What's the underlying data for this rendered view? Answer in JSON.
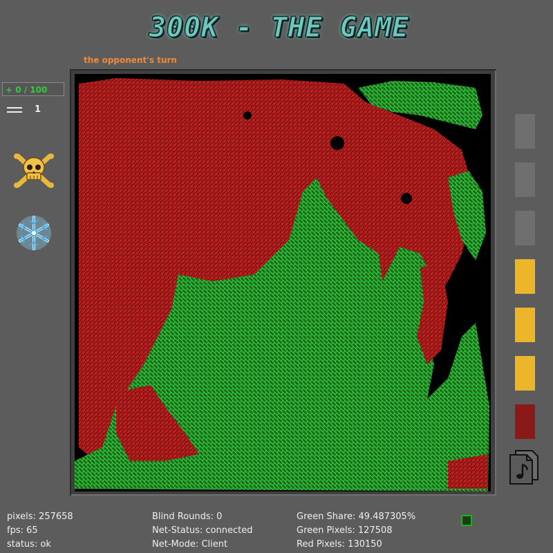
{
  "title": "300K - THE GAME",
  "turn_status": "the opponent's turn",
  "counter": "+ 0 / 100",
  "round_indicator": "1",
  "icons": {
    "menu": "menu-icon",
    "skull": "skull-crossbones-icon",
    "snowflake": "snowflake-icon",
    "music": "music-file-icon"
  },
  "colors": {
    "green_player": "#2fbb35",
    "red_player": "#c21f1f",
    "accent_orange": "#ef8a3a",
    "slot_yellow": "#edb52a",
    "slot_red": "#8a1a1a",
    "slot_empty": "#6f6f6f"
  },
  "side_slots": [
    "empty",
    "empty",
    "empty",
    "yellow",
    "yellow",
    "yellow",
    "red"
  ],
  "stats": {
    "pixels": "pixels: 257658",
    "fps": "fps: 65",
    "status": "status: ok",
    "blind_rounds": "Blind Rounds: 0",
    "net_status": "Net-Status: connected",
    "net_mode": "Net-Mode: Client",
    "green_share": "Green Share: 49.487305%",
    "green_pixels": "Green Pixels: 127508",
    "red_pixels": "Red Pixels: 130150"
  }
}
